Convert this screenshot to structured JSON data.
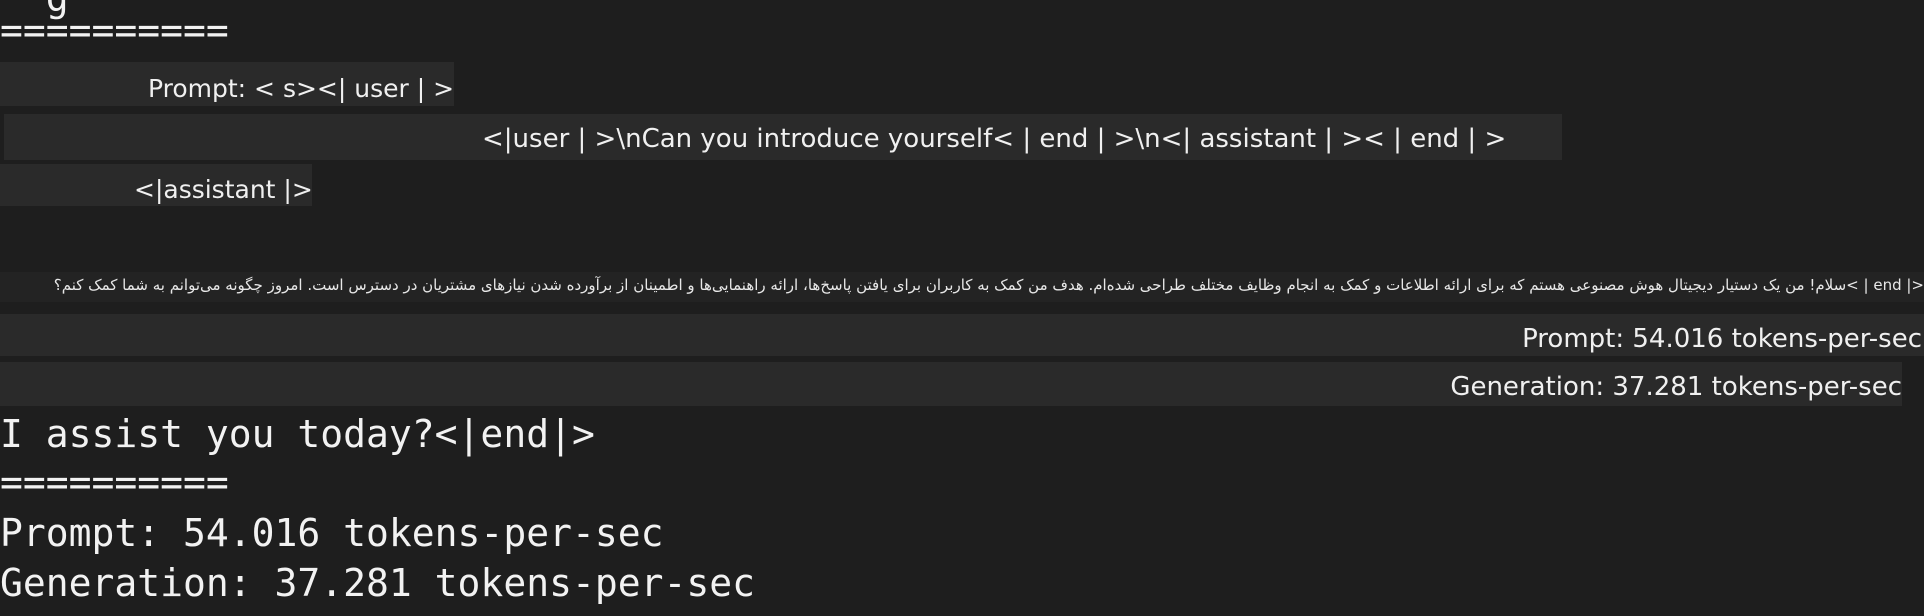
{
  "terminal": {
    "top_clipped_text": "  g",
    "separator": "==========",
    "overlay": {
      "prompt_label": "Prompt: < s><| user | >",
      "user_message_line": "<|user | >\\nCan you introduce yourself< | end | >\\n<| assistant | >< | end | >",
      "assistant_label": "<|assistant |>",
      "rtl_response": "<| end | >سلام! من یک دستیار دیجیتال هوش مصنوعی هستم که برای ارائه اطلاعات و کمک به انجام وظایف مختلف طراحی شده‌ام. هدف من کمک به کاربران برای یافتن پاسخ‌ها، ارائه راهنمایی‌ها و اطمینان از برآورده شدن نیازهای مشتریان در دسترس است. امروز چگونه می‌توانم به شما کمک کنم؟",
      "prompt_stats": "Prompt: 54.016 tokens-per-sec",
      "generation_stats": "Generation: 37.281 tokens-per-sec"
    },
    "response_tail": "I assist you today?<|end|>",
    "separator_2": "==========",
    "prompt_stats": "Prompt: 54.016 tokens-per-sec",
    "generation_stats": "Generation: 37.281 tokens-per-sec"
  },
  "colors": {
    "background": "#1e1e1e",
    "band": "#2a2a2a",
    "text": "#f2f2f2"
  }
}
